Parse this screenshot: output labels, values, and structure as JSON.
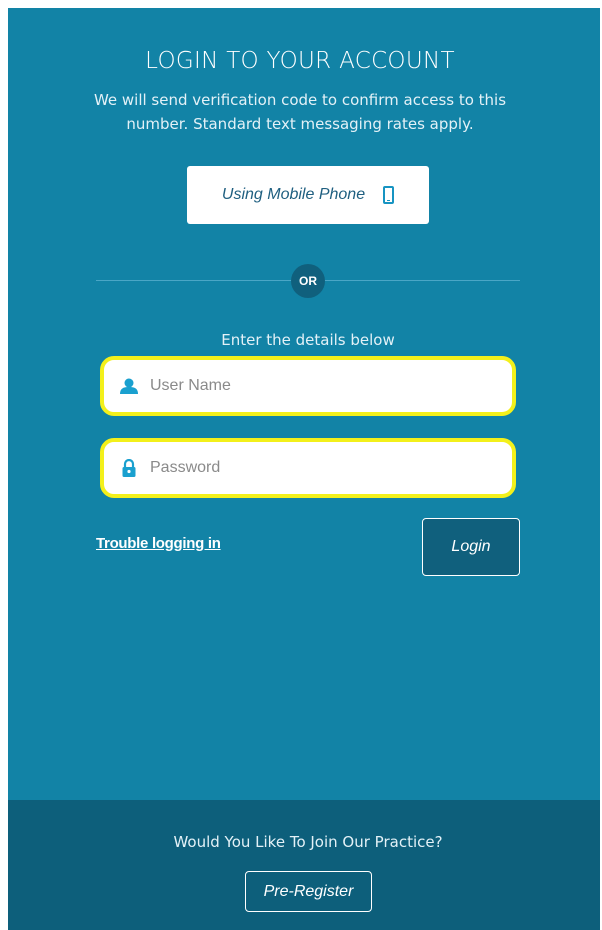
{
  "login": {
    "title": "LOGIN TO YOUR ACCOUNT",
    "subtitle": "We will send verification code to confirm access to this number. Standard text messaging rates apply.",
    "mobile_button_label": "Using Mobile Phone",
    "mobile_icon": "mobile-phone-icon",
    "or_label": "OR",
    "enter_details_label": "Enter the details below",
    "username": {
      "placeholder": "User Name",
      "value": "",
      "icon": "user-icon"
    },
    "password": {
      "placeholder": "Password",
      "value": "",
      "icon": "lock-icon"
    },
    "trouble_link": "Trouble logging in",
    "login_button_label": "Login"
  },
  "footer": {
    "join_text": "Would You Like To Join Our Practice?",
    "preregister_label": "Pre-Register"
  },
  "colors": {
    "background": "#1283a6",
    "footer_background": "#0d5f7b",
    "highlight": "#f3f01b",
    "accent_dark": "#10607d"
  }
}
